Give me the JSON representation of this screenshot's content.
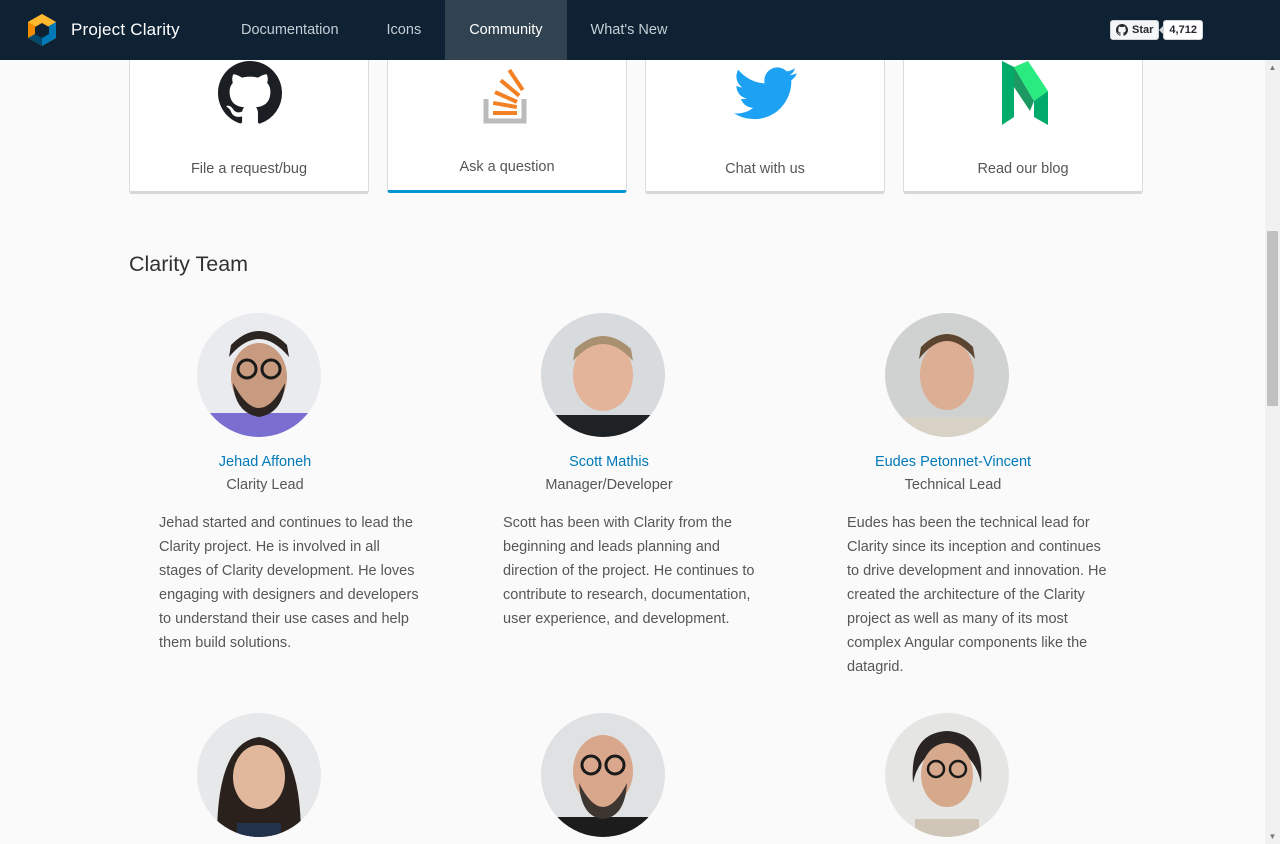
{
  "header": {
    "brand": "Project Clarity",
    "nav": [
      {
        "label": "Documentation",
        "active": false
      },
      {
        "label": "Icons",
        "active": false
      },
      {
        "label": "Community",
        "active": true
      },
      {
        "label": "What's New",
        "active": false
      }
    ],
    "github": {
      "star_label": "Star",
      "count": "4,712"
    }
  },
  "cards": [
    {
      "label": "File a request/bug",
      "icon": "github-icon"
    },
    {
      "label": "Ask a question",
      "icon": "stackoverflow-icon"
    },
    {
      "label": "Chat with us",
      "icon": "twitter-icon"
    },
    {
      "label": "Read our blog",
      "icon": "medium-icon"
    }
  ],
  "team": {
    "title": "Clarity Team",
    "members": [
      {
        "name": "Jehad Affoneh",
        "role": "Clarity Lead",
        "bio": "Jehad started and continues to lead the Clarity project. He is involved in all stages of Clarity development. He loves engaging with designers and developers to understand their use cases and help them build solutions."
      },
      {
        "name": "Scott Mathis",
        "role": "Manager/Developer",
        "bio": "Scott has been with Clarity from the beginning and leads planning and direction of the project. He continues to contribute to research, documentation, user experience, and development."
      },
      {
        "name": "Eudes Petonnet-Vincent",
        "role": "Technical Lead",
        "bio": "Eudes has been the technical lead for Clarity since its inception and continues to drive development and innovation. He created the architecture of the Clarity project as well as many of its most complex Angular components like the datagrid."
      }
    ]
  },
  "colors": {
    "header_bg": "#0e2233",
    "nav_active_bg": "#314351",
    "link": "#0079b8",
    "card_active_border": "#0094d2"
  }
}
